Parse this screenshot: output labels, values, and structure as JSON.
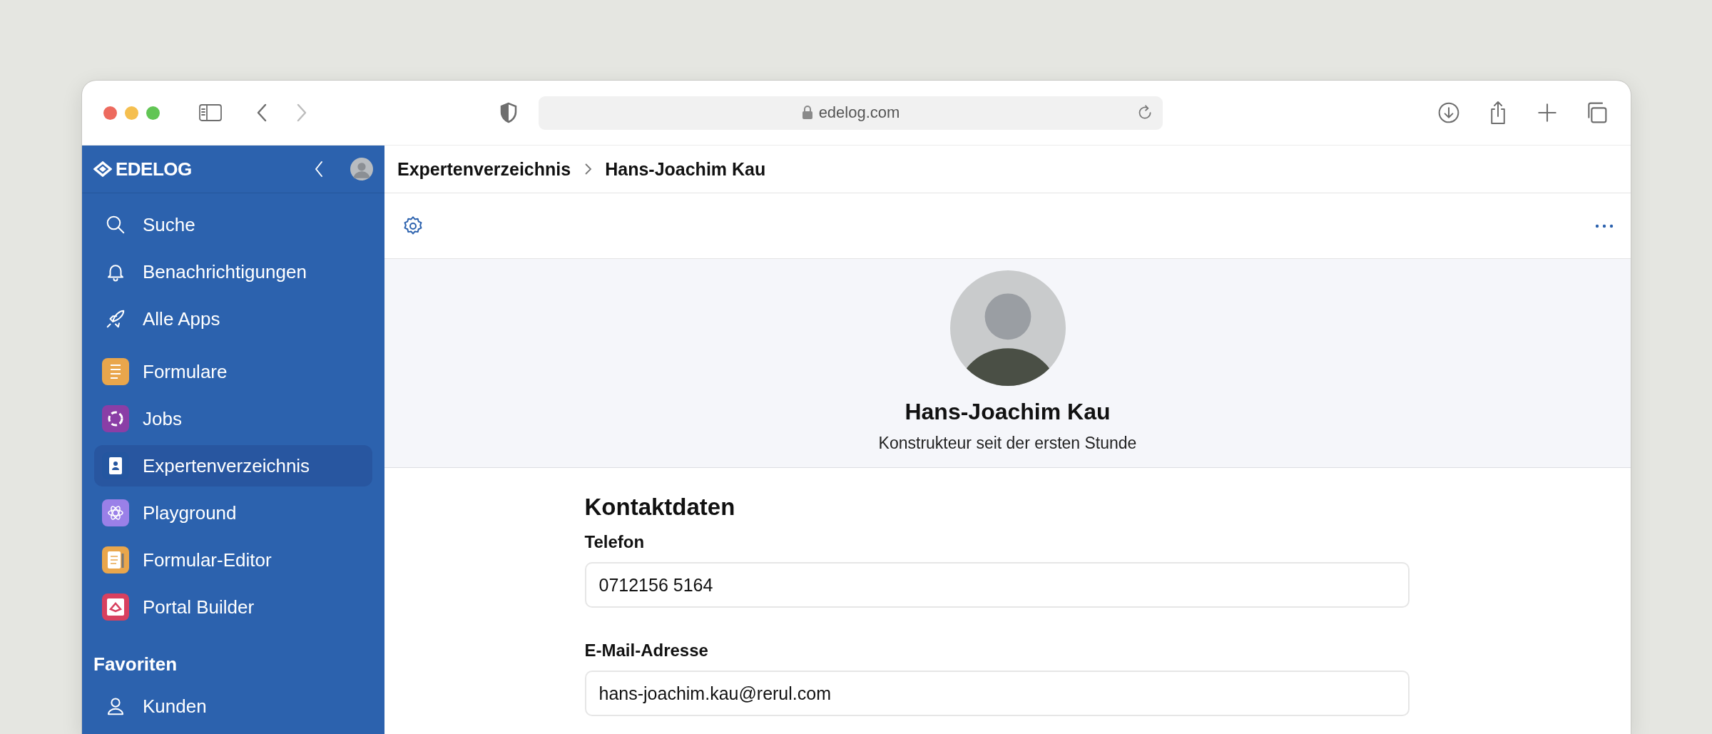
{
  "browser": {
    "url": "edelog.com"
  },
  "sidebar": {
    "logo": "EDELOG",
    "nav_items": [
      {
        "label": "Suche"
      },
      {
        "label": "Benachrichtigungen"
      },
      {
        "label": "Alle Apps"
      }
    ],
    "apps": [
      {
        "label": "Formulare",
        "color": "#e9a64c",
        "selected": false
      },
      {
        "label": "Jobs",
        "color": "#8a3ea6",
        "selected": false
      },
      {
        "label": "Expertenverzeichnis",
        "color": "#2456a0",
        "selected": true
      },
      {
        "label": "Playground",
        "color": "#9a80e8",
        "selected": false
      },
      {
        "label": "Formular-Editor",
        "color": "#e9a64c",
        "selected": false
      },
      {
        "label": "Portal Builder",
        "color": "#d8405f",
        "selected": false
      }
    ],
    "favorites": {
      "title": "Favoriten",
      "items": [
        {
          "label": "Kunden"
        }
      ]
    }
  },
  "breadcrumb": [
    "Expertenverzeichnis",
    "Hans-Joachim Kau"
  ],
  "profile": {
    "name": "Hans-Joachim Kau",
    "subtitle": "Konstrukteur seit der ersten Stunde"
  },
  "contact": {
    "title": "Kontaktdaten",
    "fields": [
      {
        "label": "Telefon",
        "value": "0712156 5164"
      },
      {
        "label": "E-Mail-Adresse",
        "value": "hans-joachim.kau@rerul.com"
      }
    ]
  }
}
